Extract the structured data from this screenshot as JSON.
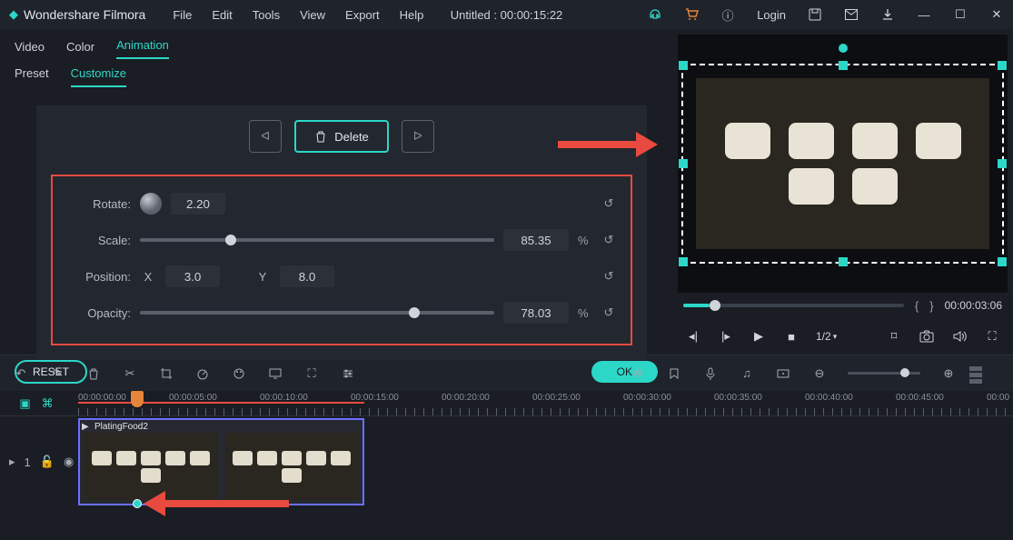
{
  "app": {
    "name": "Wondershare Filmora"
  },
  "menu": {
    "items": [
      "File",
      "Edit",
      "Tools",
      "View",
      "Export",
      "Help"
    ]
  },
  "doc": {
    "title": "Untitled : 00:00:15:22"
  },
  "login": "Login",
  "tabs": {
    "video": "Video",
    "color": "Color",
    "animation": "Animation"
  },
  "subtabs": {
    "preset": "Preset",
    "customize": "Customize"
  },
  "buttons": {
    "delete": "Delete",
    "reset": "RESET",
    "ok": "OK"
  },
  "props": {
    "rotate": {
      "label": "Rotate:",
      "value": "2.20"
    },
    "scale": {
      "label": "Scale:",
      "value": "85.35",
      "pct": 24
    },
    "position": {
      "label": "Position:",
      "xLabel": "X",
      "x": "3.0",
      "yLabel": "Y",
      "y": "8.0"
    },
    "opacity": {
      "label": "Opacity:",
      "value": "78.03",
      "pct": 76
    }
  },
  "preview": {
    "time": "00:00:03:06",
    "speed": "1/2"
  },
  "timeline": {
    "ticks": [
      "00:00:00:00",
      "00:00:05:00",
      "00:00:10:00",
      "00:00:15:00",
      "00:00:20:00",
      "00:00:25:00",
      "00:00:30:00",
      "00:00:35:00",
      "00:00:40:00",
      "00:00:45:00",
      "00:00"
    ],
    "clipName": "PlatingFood2",
    "trackLabel": "1"
  }
}
